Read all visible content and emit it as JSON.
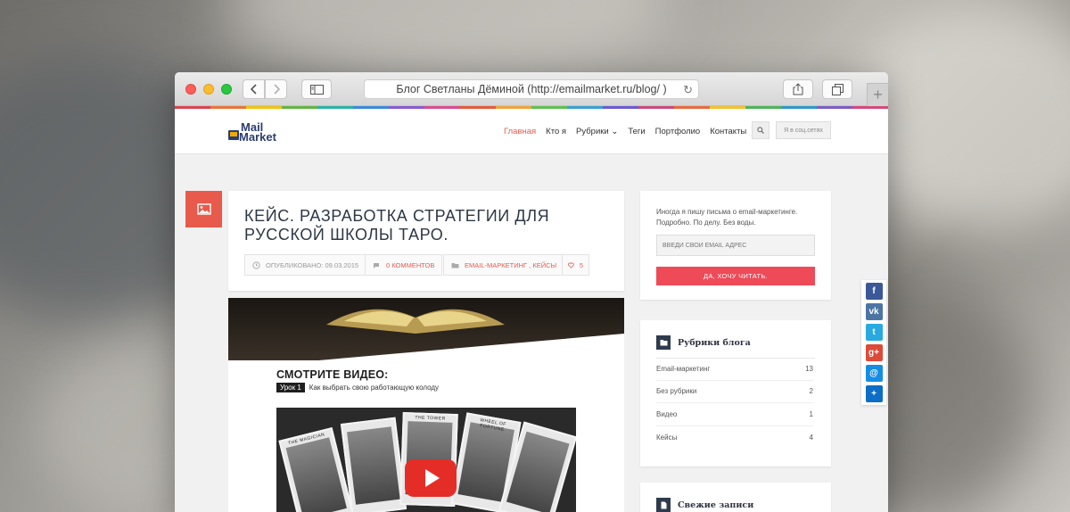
{
  "browser": {
    "url_text": "Блог Светланы Дёминой (http://emailmarket.ru/blog/ )",
    "new_tab_label": "+"
  },
  "site": {
    "logo": {
      "line1": "ail",
      "line2": "arket",
      "prefix_1": "M",
      "prefix_2": "M"
    },
    "nav": [
      {
        "label": "Главная",
        "active": true
      },
      {
        "label": "Кто я"
      },
      {
        "label": "Рубрики ⌄"
      },
      {
        "label": "Теги"
      },
      {
        "label": "Портфолио"
      },
      {
        "label": "Контакты"
      }
    ],
    "social_label": "Я в соц.сетях"
  },
  "post": {
    "title": "КЕЙС. РАЗРАБОТКА СТРАТЕГИИ ДЛЯ РУССКОЙ ШКОЛЫ ТАРО.",
    "published": "ОПУБЛИКОВАНО: 09.03.2015",
    "comments": "0 КОММЕНТОВ",
    "categories": "EMAIL-МАРКЕТИНГ , КЕЙСЫ",
    "likes": "5",
    "image": {
      "heading": "СМОТРИТЕ ВИДЕО:",
      "lesson_tag": "Урок 1",
      "lesson_text": "Как выбрать свою работающую колоду",
      "cards": [
        "THE MAGICIAN",
        "",
        "THE TOWER",
        "WHEEL OF FORTUNE",
        ""
      ]
    }
  },
  "sidebar": {
    "subscribe": {
      "text": "Иногда я пишу письма о email-маркетинге. Подробно. По делу. Без воды.",
      "email_placeholder": "ВВЕДИ СВОЙ EMAIL АДРЕС",
      "button": "ДА, ХОЧУ ЧИТАТЬ."
    },
    "categories": {
      "title": "Рубрики блога",
      "items": [
        {
          "label": "Email-маркетинг",
          "count": "13"
        },
        {
          "label": "Без рубрики",
          "count": "2"
        },
        {
          "label": "Видео",
          "count": "1"
        },
        {
          "label": "Кейсы",
          "count": "4"
        }
      ]
    },
    "recent": {
      "title": "Свежие записи"
    }
  },
  "share": [
    {
      "name": "facebook",
      "glyph": "f",
      "color": "#3b5998"
    },
    {
      "name": "vkontakte",
      "glyph": "vk",
      "color": "#4c75a3"
    },
    {
      "name": "twitter",
      "glyph": "t",
      "color": "#28a9e0"
    },
    {
      "name": "google-plus",
      "glyph": "g+",
      "color": "#dc4a38"
    },
    {
      "name": "mail",
      "glyph": "@",
      "color": "#168de2"
    },
    {
      "name": "share-more",
      "glyph": "+",
      "color": "#0d6ec5"
    }
  ],
  "colors": {
    "accent": "#e85a4f",
    "brand": "#2b3d70",
    "button": "#ee4a58",
    "rainbow": [
      "#d9434e",
      "#e8743b",
      "#f1c40f",
      "#63b542",
      "#2bb3a6",
      "#3c8ad9",
      "#8a5ad1",
      "#d94c8f",
      "#e55b3c",
      "#f0a43b",
      "#5fbf4e",
      "#3aa0d0",
      "#6b5ad6",
      "#c84a7d",
      "#e86a3f",
      "#f2c230",
      "#4fb35a",
      "#2f98c9",
      "#7d5cc7",
      "#d5497c"
    ]
  }
}
